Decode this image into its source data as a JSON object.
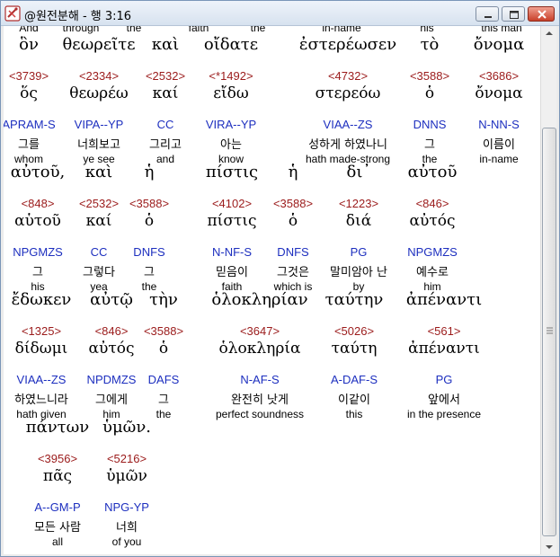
{
  "window": {
    "title": "@원전분해 - 행 3:16"
  },
  "top_row": [
    "And",
    "through",
    "the",
    "faith",
    "the",
    "in-name",
    "his",
    "this man"
  ],
  "rows": [
    {
      "words": [
        {
          "greek": "ὃν",
          "strong": "<3739>",
          "lemma": "ὅς",
          "parse": "APRAM-S",
          "korean": "그를",
          "english": "whom"
        },
        {
          "greek": "θεωρεῖτε",
          "strong": "<2334>",
          "lemma": "θεωρέω",
          "parse": "VIPA--YP",
          "korean": "너희보고",
          "english": "ye see"
        },
        {
          "greek": "καὶ",
          "strong": "<2532>",
          "lemma": "καί",
          "parse": "CC",
          "korean": "그리고",
          "english": "and"
        },
        {
          "greek": "οἴδατε",
          "strong": "<*1492>",
          "lemma": "εἴδω",
          "parse": "VIRA--YP",
          "korean": "아는",
          "english": "know"
        },
        {
          "greek": "ἐστερέωσεν",
          "strong": "<4732>",
          "lemma": "στερεόω",
          "parse": "VIAA--ZS",
          "korean": "성하게 하였나니",
          "english": "hath made-strong"
        },
        {
          "greek": "τὸ",
          "strong": "<3588>",
          "lemma": "ὁ",
          "parse": "DNNS",
          "korean": "그",
          "english": "the"
        },
        {
          "greek": "ὄνομα",
          "strong": "<3686>",
          "lemma": "ὄνομα",
          "parse": "N-NN-S",
          "korean": "이름이",
          "english": "in-name"
        }
      ]
    },
    {
      "words": [
        {
          "greek": "αὐτοῦ,",
          "strong": "<848>",
          "lemma": "αὑτοῦ",
          "parse": "NPGMZS",
          "korean": "그",
          "english": "his"
        },
        {
          "greek": "καὶ",
          "strong": "<2532>",
          "lemma": "καί",
          "parse": "CC",
          "korean": "그렇다",
          "english": "yea"
        },
        {
          "greek": "ἡ",
          "strong": "<3588>",
          "lemma": "ὁ",
          "parse": "DNFS",
          "korean": "그",
          "english": "the"
        },
        {
          "greek": "πίστις",
          "strong": "<4102>",
          "lemma": "πίστις",
          "parse": "N-NF-S",
          "korean": "믿음이",
          "english": "faith"
        },
        {
          "greek": "ἡ",
          "strong": "<3588>",
          "lemma": "ὁ",
          "parse": "DNFS",
          "korean": "그것은",
          "english": "which is"
        },
        {
          "greek": "δι᾽",
          "strong": "<1223>",
          "lemma": "διά",
          "parse": "PG",
          "korean": "말미암아 난",
          "english": "by"
        },
        {
          "greek": "αὐτοῦ",
          "strong": "<846>",
          "lemma": "αὐτός",
          "parse": "NPGMZS",
          "korean": "예수로",
          "english": "him"
        }
      ]
    },
    {
      "words": [
        {
          "greek": "ἔδωκεν",
          "strong": "<1325>",
          "lemma": "δίδωμι",
          "parse": "VIAA--ZS",
          "korean": "하였느니라",
          "english": "hath given"
        },
        {
          "greek": "αὐτῷ",
          "strong": "<846>",
          "lemma": "αὐτός",
          "parse": "NPDMZS",
          "korean": "그에게",
          "english": "him"
        },
        {
          "greek": "τὴν",
          "strong": "<3588>",
          "lemma": "ὁ",
          "parse": "DAFS",
          "korean": "그",
          "english": "the"
        },
        {
          "greek": "ὁλοκληρίαν",
          "strong": "<3647>",
          "lemma": "ὁλοκληρία",
          "parse": "N-AF-S",
          "korean": "완전히 낫게",
          "english": "perfect soundness"
        },
        {
          "greek": "ταύτην",
          "strong": "<5026>",
          "lemma": "ταύτη",
          "parse": "A-DAF-S",
          "korean": "이같이",
          "english": "this"
        },
        {
          "greek": "ἀπέναντι",
          "strong": "<561>",
          "lemma": "ἀπέναντι",
          "parse": "PG",
          "korean": "앞에서",
          "english": "in the presence"
        }
      ]
    },
    {
      "words": [
        {
          "greek": "πάντων",
          "strong": "<3956>",
          "lemma": "πᾶς",
          "parse": "A--GM-P",
          "korean": "모든 사람",
          "english": "all"
        },
        {
          "greek": "ὑμῶν.",
          "strong": "<5216>",
          "lemma": "ὑμῶν",
          "parse": "NPG-YP",
          "korean": "너희",
          "english": "of you"
        }
      ]
    }
  ]
}
